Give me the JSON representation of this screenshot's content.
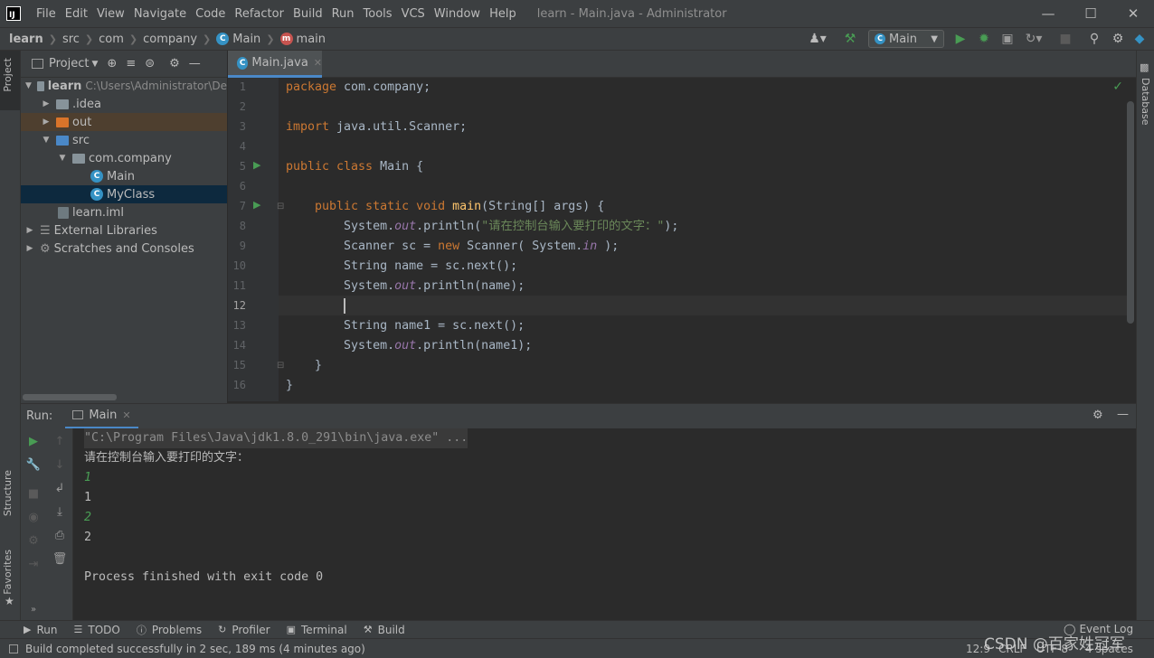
{
  "window": {
    "menu": [
      "File",
      "Edit",
      "View",
      "Navigate",
      "Code",
      "Refactor",
      "Build",
      "Run",
      "Tools",
      "VCS",
      "Window",
      "Help"
    ],
    "title": "learn - Main.java - Administrator"
  },
  "breadcrumb": {
    "items": [
      "learn",
      "src",
      "com",
      "company",
      "Main",
      "main"
    ]
  },
  "toolbar": {
    "run_config": "Main"
  },
  "left_stripe": {
    "project": "Project",
    "structure": "Structure",
    "favorites": "Favorites"
  },
  "right_stripe": {
    "database": "Database"
  },
  "project_panel": {
    "title": "Project",
    "tree": [
      {
        "label": "learn",
        "path": "C:\\Users\\Administrator\\De"
      },
      {
        "label": ".idea"
      },
      {
        "label": "out"
      },
      {
        "label": "src"
      },
      {
        "label": "com.company"
      },
      {
        "label": "Main"
      },
      {
        "label": "MyClass"
      },
      {
        "label": "learn.iml"
      },
      {
        "label": "External Libraries"
      },
      {
        "label": "Scratches and Consoles"
      }
    ]
  },
  "editor": {
    "tab": "Main.java",
    "line_numbers": [
      "1",
      "2",
      "3",
      "4",
      "5",
      "6",
      "7",
      "8",
      "9",
      "10",
      "11",
      "12",
      "13",
      "14",
      "15",
      "16"
    ],
    "code": {
      "l1_kw": "package",
      "l1_rest": " com.company;",
      "l3_kw": "import",
      "l3_rest": " java.util.Scanner;",
      "l5_kw": "public class",
      "l5_rest": " Main {",
      "l7_kw": "    public static void",
      "l7_fn": " main",
      "l7_rest": "(String[] args) {",
      "l8_a": "        System.",
      "l8_fld": "out",
      "l8_b": ".println(",
      "l8_str": "\"请在控制台输入要打印的文字：\"",
      "l8_c": ");",
      "l9_a": "        Scanner sc = ",
      "l9_kw": "new",
      "l9_b": " Scanner( System.",
      "l9_fld": "in",
      "l9_c": " );",
      "l10": "        String name = sc.next();",
      "l11_a": "        System.",
      "l11_fld": "out",
      "l11_b": ".println(name);",
      "l13": "        String name1 = sc.next();",
      "l14_a": "        System.",
      "l14_fld": "out",
      "l14_b": ".println(name1);",
      "l15": "    }",
      "l16": "}"
    }
  },
  "run_panel": {
    "label": "Run:",
    "tab": "Main",
    "output": [
      {
        "text": "\"C:\\Program Files\\Java\\jdk1.8.0_291\\bin\\java.exe\" ...",
        "type": "cmd"
      },
      {
        "text": "请在控制台输入要打印的文字：",
        "type": "out"
      },
      {
        "text": "1",
        "type": "in"
      },
      {
        "text": "1",
        "type": "out"
      },
      {
        "text": "2",
        "type": "in"
      },
      {
        "text": "2",
        "type": "out"
      },
      {
        "text": "",
        "type": "out"
      },
      {
        "text": "Process finished with exit code 0",
        "type": "out"
      }
    ]
  },
  "bottom_tabs": [
    "Run",
    "TODO",
    "Problems",
    "Profiler",
    "Terminal",
    "Build"
  ],
  "status": {
    "message": "Build completed successfully in 2 sec, 189 ms (4 minutes ago)",
    "position": "12:9",
    "line_sep": "CRLF",
    "encoding": "UTF-8",
    "indent": "4 spaces",
    "event_log": "Event Log"
  },
  "watermark": "CSDN @百家姓冠军"
}
